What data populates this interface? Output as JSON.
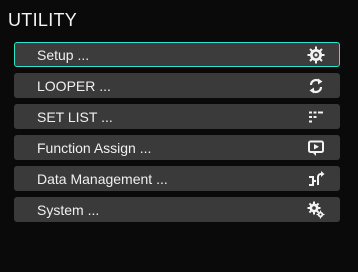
{
  "header": {
    "title": "UTILITY"
  },
  "menu": {
    "items": [
      {
        "label": "Setup ...",
        "icon": "gear-icon"
      },
      {
        "label": "LOOPER ...",
        "icon": "loop-arrows-icon"
      },
      {
        "label": "SET LIST ...",
        "icon": "list-icon"
      },
      {
        "label": "Function Assign ...",
        "icon": "assign-screen-icon"
      },
      {
        "label": "Data Management ...",
        "icon": "data-export-icon"
      },
      {
        "label": "System ...",
        "icon": "system-gears-icon"
      }
    ],
    "selected_index": 0
  },
  "colors": {
    "background": "#0a0a0a",
    "item_background": "#3a3a3a",
    "selection_outline": "#2ee6c6",
    "text": "#f0f0f0"
  }
}
